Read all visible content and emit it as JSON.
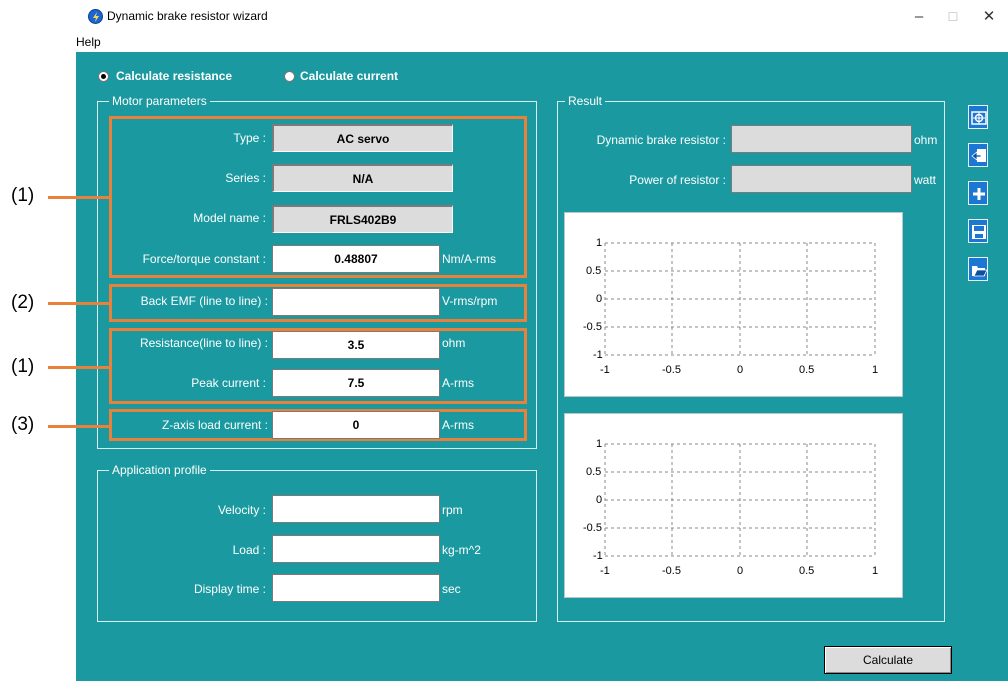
{
  "window": {
    "title": "Dynamic brake resistor wizard",
    "minimize": "–",
    "maximize": "☐",
    "close": "✕"
  },
  "menu": {
    "help": "Help"
  },
  "mode": {
    "calc_resistance": "Calculate resistance",
    "calc_current": "Calculate current",
    "selected": "Calculate resistance"
  },
  "motor": {
    "group_label": "Motor parameters",
    "type_label": "Type :",
    "type_value": "AC servo",
    "series_label": "Series :",
    "series_value": "N/A",
    "model_label": "Model name :",
    "model_value": "FRLS402B9",
    "force_label": "Force/torque constant :",
    "force_value": "0.48807",
    "force_unit": "Nm/A-rms",
    "emf_label": "Back EMF (line to line) :",
    "emf_value": "",
    "emf_unit": "V-rms/rpm",
    "res_label": "Resistance(line to line) :",
    "res_value": "3.5",
    "res_unit": "ohm",
    "peak_label": "Peak current :",
    "peak_value": "7.5",
    "peak_unit": "A-rms",
    "z_label": "Z-axis load current :",
    "z_value": "0",
    "z_unit": "A-rms"
  },
  "application": {
    "group_label": "Application profile",
    "velocity_label": "Velocity :",
    "velocity_value": "",
    "velocity_unit": "rpm",
    "load_label": "Load :",
    "load_value": "",
    "load_unit": "kg-m^2",
    "display_label": "Display time :",
    "display_value": "",
    "display_unit": "sec"
  },
  "result": {
    "group_label": "Result",
    "dbr_label": "Dynamic brake resistor :",
    "dbr_value": "",
    "dbr_unit": "ohm",
    "power_label": "Power of resistor :",
    "power_value": "",
    "power_unit": "watt"
  },
  "annotations": [
    "(1)",
    "(2)",
    "(1)",
    "(3)"
  ],
  "toolbar_icons": [
    "folder-target-icon",
    "export-icon",
    "add-icon",
    "save-icon",
    "open-folder-icon"
  ],
  "plot_axes": {
    "y_ticks": [
      "1",
      "0.5",
      "0",
      "-0.5",
      "-1"
    ],
    "x_ticks": [
      "-1",
      "-0.5",
      "0",
      "0.5",
      "1"
    ]
  },
  "calculate_label": "Calculate",
  "colors": {
    "background": "#1a9aa0",
    "highlight": "#e8823a",
    "toolbar": "#1b77d1"
  }
}
